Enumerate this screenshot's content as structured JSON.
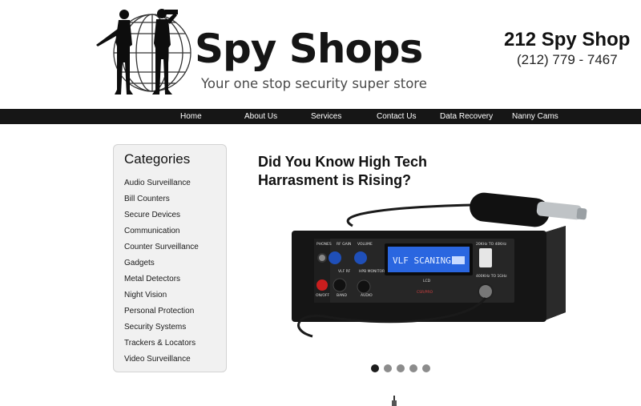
{
  "header": {
    "brand_title": "Spy Shops",
    "tagline": "Your one stop security super store",
    "shop_name": "212 Spy Shop",
    "phone": "(212) 779 - 7467"
  },
  "nav": {
    "items": [
      {
        "label": "Home"
      },
      {
        "label": "About Us"
      },
      {
        "label": "Services"
      },
      {
        "label": "Contact Us"
      },
      {
        "label": "Data Recovery"
      },
      {
        "label": "Nanny Cams"
      }
    ]
  },
  "sidebar": {
    "title": "Categories",
    "items": [
      {
        "label": "Audio Surveillance"
      },
      {
        "label": "Bill Counters"
      },
      {
        "label": "Secure Devices"
      },
      {
        "label": "Communication"
      },
      {
        "label": "Counter Surveillance"
      },
      {
        "label": "Gadgets"
      },
      {
        "label": "Metal Detectors"
      },
      {
        "label": "Night Vision"
      },
      {
        "label": "Personal Protection"
      },
      {
        "label": "Security Systems"
      },
      {
        "label": "Trackers & Locators"
      },
      {
        "label": "Video Surveillance"
      }
    ]
  },
  "slider": {
    "title": "Did You Know High Tech Harrasment is Rising?",
    "active_index": 0,
    "device": {
      "screen_text": "VLF SCANING",
      "label_phones": "PHONES",
      "label_rf_gain": "RF GAIN",
      "label_volume": "VOLUME",
      "label_vlf": "VLF RF",
      "label_hpb": "HPB MONITOR",
      "label_band": "BAND",
      "label_audio": "AUDIO",
      "label_onoff": "ON/OFF",
      "label_lcd": "LCD",
      "label_model": "CSR/PRO",
      "label_side_top": "20KHz TO 40KHz",
      "label_side_bottom": "400KHz TO 1GHz"
    }
  },
  "colors": {
    "nav_background": "#161616",
    "sidebar_background": "#f1f1f1",
    "knob_blue": "#1f4fb8",
    "lcd_blue": "#2a66e0",
    "power_red": "#c81e1e"
  }
}
